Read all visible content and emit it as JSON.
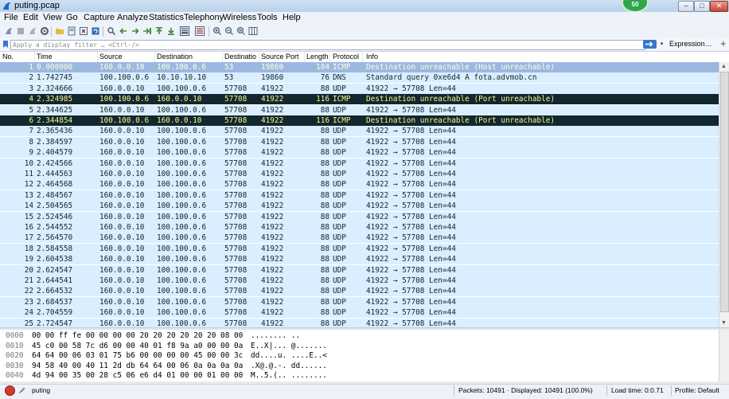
{
  "window": {
    "title": "puting.pcap",
    "badge": "50"
  },
  "window_controls": {
    "minimize": "–",
    "maximize": "□",
    "close": "✕"
  },
  "menu": [
    "File",
    "Edit",
    "View",
    "Go",
    "Capture",
    "Analyze",
    "Statistics",
    "Telephony",
    "Wireless",
    "Tools",
    "Help"
  ],
  "filter": {
    "placeholder": "Apply a display filter … <Ctrl-/>",
    "expression_label": "Expression…",
    "plus_label": "+",
    "dropdown_glyph": "▾"
  },
  "columns": [
    "No.",
    "Time",
    "Source",
    "Destination",
    "Destinatio",
    "Source Port",
    "Length",
    "Protocol",
    "Info"
  ],
  "packets": [
    {
      "no": "1",
      "time": "0.000000",
      "src": "160.0.0.10",
      "dst": "100.100.0.6",
      "dport": "53",
      "sport": "19860",
      "len": "104",
      "proto": "ICMP",
      "info": "Destination unreachable (Host unreachable)",
      "style": "selected"
    },
    {
      "no": "2",
      "time": "1.742745",
      "src": "100.100.0.6",
      "dst": "10.10.10.10",
      "dport": "53",
      "sport": "19860",
      "len": "76",
      "proto": "DNS",
      "info": "Standard query 0xe6d4 A fota.advmob.cn",
      "style": "normal"
    },
    {
      "no": "3",
      "time": "2.324666",
      "src": "160.0.0.10",
      "dst": "100.100.0.6",
      "dport": "57708",
      "sport": "41922",
      "len": "88",
      "proto": "UDP",
      "info": "41922 → 57708  Len=44",
      "style": "normal"
    },
    {
      "no": "4",
      "time": "2.324985",
      "src": "100.100.0.6",
      "dst": "160.0.0.10",
      "dport": "57708",
      "sport": "41922",
      "len": "116",
      "proto": "ICMP",
      "info": "Destination unreachable (Port unreachable)",
      "style": "dark"
    },
    {
      "no": "5",
      "time": "2.344625",
      "src": "160.0.0.10",
      "dst": "100.100.0.6",
      "dport": "57708",
      "sport": "41922",
      "len": "88",
      "proto": "UDP",
      "info": "41922 → 57708  Len=44",
      "style": "normal"
    },
    {
      "no": "6",
      "time": "2.344854",
      "src": "100.100.0.6",
      "dst": "160.0.0.10",
      "dport": "57708",
      "sport": "41922",
      "len": "116",
      "proto": "ICMP",
      "info": "Destination unreachable (Port unreachable)",
      "style": "dark"
    },
    {
      "no": "7",
      "time": "2.365436",
      "src": "160.0.0.10",
      "dst": "100.100.0.6",
      "dport": "57708",
      "sport": "41922",
      "len": "88",
      "proto": "UDP",
      "info": "41922 → 57708  Len=44",
      "style": "normal"
    },
    {
      "no": "8",
      "time": "2.384597",
      "src": "160.0.0.10",
      "dst": "100.100.0.6",
      "dport": "57708",
      "sport": "41922",
      "len": "88",
      "proto": "UDP",
      "info": "41922 → 57708  Len=44",
      "style": "normal"
    },
    {
      "no": "9",
      "time": "2.404579",
      "src": "160.0.0.10",
      "dst": "100.100.0.6",
      "dport": "57708",
      "sport": "41922",
      "len": "88",
      "proto": "UDP",
      "info": "41922 → 57708  Len=44",
      "style": "normal"
    },
    {
      "no": "10",
      "time": "2.424566",
      "src": "160.0.0.10",
      "dst": "100.100.0.6",
      "dport": "57708",
      "sport": "41922",
      "len": "88",
      "proto": "UDP",
      "info": "41922 → 57708  Len=44",
      "style": "normal"
    },
    {
      "no": "11",
      "time": "2.444563",
      "src": "160.0.0.10",
      "dst": "100.100.0.6",
      "dport": "57708",
      "sport": "41922",
      "len": "88",
      "proto": "UDP",
      "info": "41922 → 57708  Len=44",
      "style": "normal"
    },
    {
      "no": "12",
      "time": "2.464568",
      "src": "160.0.0.10",
      "dst": "100.100.0.6",
      "dport": "57708",
      "sport": "41922",
      "len": "88",
      "proto": "UDP",
      "info": "41922 → 57708  Len=44",
      "style": "normal"
    },
    {
      "no": "13",
      "time": "2.484567",
      "src": "160.0.0.10",
      "dst": "100.100.0.6",
      "dport": "57708",
      "sport": "41922",
      "len": "88",
      "proto": "UDP",
      "info": "41922 → 57708  Len=44",
      "style": "normal"
    },
    {
      "no": "14",
      "time": "2.504565",
      "src": "160.0.0.10",
      "dst": "100.100.0.6",
      "dport": "57708",
      "sport": "41922",
      "len": "88",
      "proto": "UDP",
      "info": "41922 → 57708  Len=44",
      "style": "normal"
    },
    {
      "no": "15",
      "time": "2.524546",
      "src": "160.0.0.10",
      "dst": "100.100.0.6",
      "dport": "57708",
      "sport": "41922",
      "len": "88",
      "proto": "UDP",
      "info": "41922 → 57708  Len=44",
      "style": "normal"
    },
    {
      "no": "16",
      "time": "2.544552",
      "src": "160.0.0.10",
      "dst": "100.100.0.6",
      "dport": "57708",
      "sport": "41922",
      "len": "88",
      "proto": "UDP",
      "info": "41922 → 57708  Len=44",
      "style": "normal"
    },
    {
      "no": "17",
      "time": "2.564570",
      "src": "160.0.0.10",
      "dst": "100.100.0.6",
      "dport": "57708",
      "sport": "41922",
      "len": "88",
      "proto": "UDP",
      "info": "41922 → 57708  Len=44",
      "style": "normal"
    },
    {
      "no": "18",
      "time": "2.584558",
      "src": "160.0.0.10",
      "dst": "100.100.0.6",
      "dport": "57708",
      "sport": "41922",
      "len": "88",
      "proto": "UDP",
      "info": "41922 → 57708  Len=44",
      "style": "normal"
    },
    {
      "no": "19",
      "time": "2.604538",
      "src": "160.0.0.10",
      "dst": "100.100.0.6",
      "dport": "57708",
      "sport": "41922",
      "len": "88",
      "proto": "UDP",
      "info": "41922 → 57708  Len=44",
      "style": "normal"
    },
    {
      "no": "20",
      "time": "2.624547",
      "src": "160.0.0.10",
      "dst": "100.100.0.6",
      "dport": "57708",
      "sport": "41922",
      "len": "88",
      "proto": "UDP",
      "info": "41922 → 57708  Len=44",
      "style": "normal"
    },
    {
      "no": "21",
      "time": "2.644541",
      "src": "160.0.0.10",
      "dst": "100.100.0.6",
      "dport": "57708",
      "sport": "41922",
      "len": "88",
      "proto": "UDP",
      "info": "41922 → 57708  Len=44",
      "style": "normal"
    },
    {
      "no": "22",
      "time": "2.664532",
      "src": "160.0.0.10",
      "dst": "100.100.0.6",
      "dport": "57708",
      "sport": "41922",
      "len": "88",
      "proto": "UDP",
      "info": "41922 → 57708  Len=44",
      "style": "normal"
    },
    {
      "no": "23",
      "time": "2.684537",
      "src": "160.0.0.10",
      "dst": "100.100.0.6",
      "dport": "57708",
      "sport": "41922",
      "len": "88",
      "proto": "UDP",
      "info": "41922 → 57708  Len=44",
      "style": "normal"
    },
    {
      "no": "24",
      "time": "2.704559",
      "src": "160.0.0.10",
      "dst": "100.100.0.6",
      "dport": "57708",
      "sport": "41922",
      "len": "88",
      "proto": "UDP",
      "info": "41922 → 57708  Len=44",
      "style": "normal"
    },
    {
      "no": "25",
      "time": "2.724547",
      "src": "160.0.0.10",
      "dst": "100.100.0.6",
      "dport": "57708",
      "sport": "41922",
      "len": "88",
      "proto": "UDP",
      "info": "41922 → 57708  Len=44",
      "style": "normal"
    }
  ],
  "row_colors": {
    "normal_bg": "#daeeff",
    "normal_fg": "#12272e",
    "selected_bg": "#9bb8e0",
    "selected_fg": "#ffffe0",
    "dark_bg": "#12272e",
    "dark_fg": "#f7f78e"
  },
  "hex_dump": [
    {
      "offset": "0000",
      "bytes": "00 00 ff fe 00 00 00 00  20 20 20 20 20 20 08 00",
      "ascii": "........         .."
    },
    {
      "offset": "0010",
      "bytes": "45 c0 00 58 7c d6 00 00  40 01 f8 9a a0 00 00 0a",
      "ascii": "E..X|... @......."
    },
    {
      "offset": "0020",
      "bytes": "64 64 00 06 03 01 75 b6  00 00 00 00 45 00 00 3c",
      "ascii": "dd....u. ....E..<"
    },
    {
      "offset": "0030",
      "bytes": "94 58 40 00 40 11 2d db  64 64 00 06 0a 0a 0a 0a",
      "ascii": ".X@.@.-. dd......"
    },
    {
      "offset": "0040",
      "bytes": "4d 94 00 35 00 28 c5 06  e6 d4 01 00 00 01 00 00",
      "ascii": "M..5.(.. ........"
    }
  ],
  "status": {
    "file": "puting",
    "packets": "Packets: 10491 · Displayed: 10491 (100.0%)",
    "load_time": "Load time: 0:0.71",
    "profile": "Profile: Default"
  }
}
